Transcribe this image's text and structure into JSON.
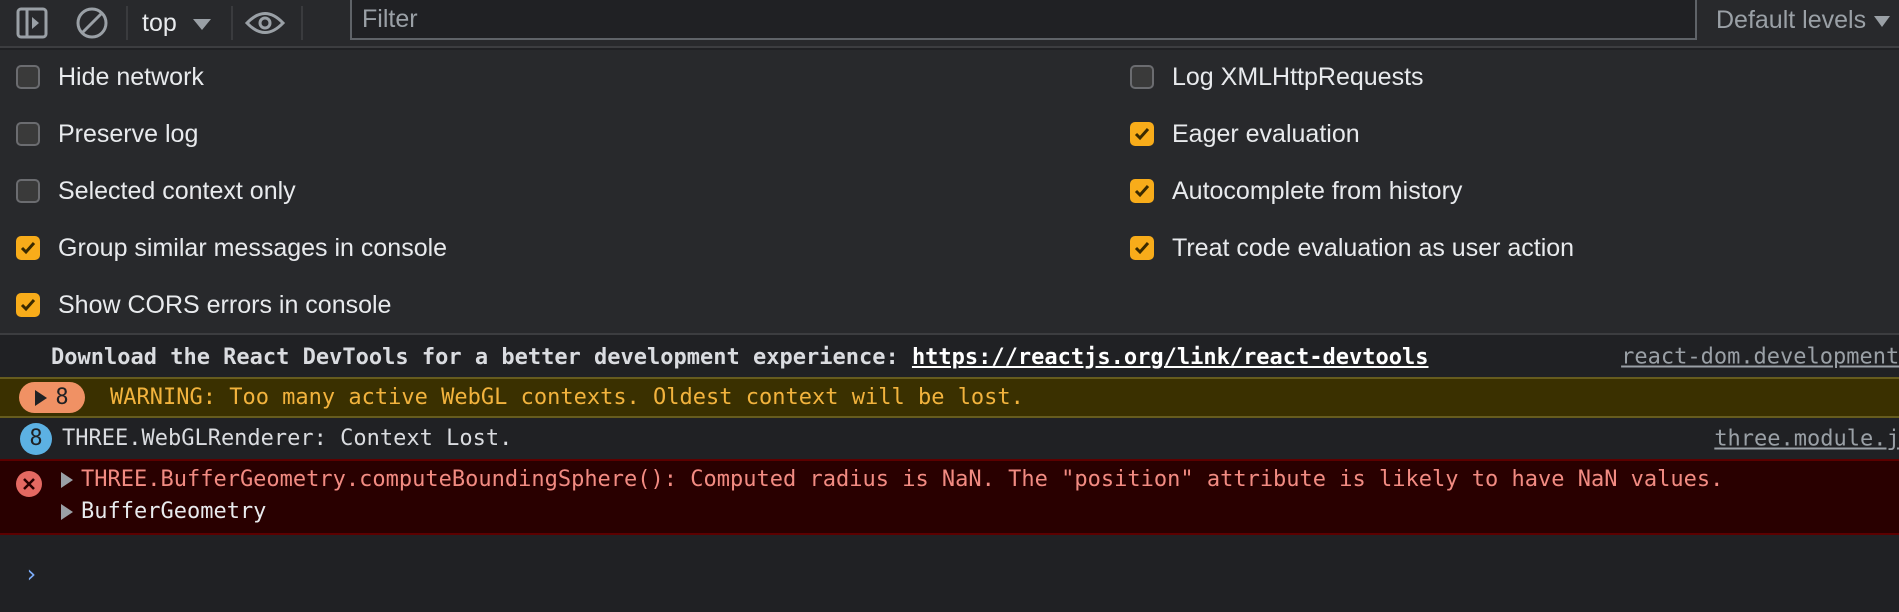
{
  "toolbar": {
    "context": "top",
    "filter_placeholder": "Filter",
    "filter_value": "",
    "levels": "Default levels",
    "icons": [
      "sidebar-toggle-icon",
      "clear-console-icon",
      "eye-icon"
    ]
  },
  "settings": {
    "left": [
      {
        "label": "Hide network",
        "checked": false
      },
      {
        "label": "Preserve log",
        "checked": false
      },
      {
        "label": "Selected context only",
        "checked": false
      },
      {
        "label": "Group similar messages in console",
        "checked": true
      },
      {
        "label": "Show CORS errors in console",
        "checked": true
      }
    ],
    "right": [
      {
        "label": "Log XMLHttpRequests",
        "checked": false
      },
      {
        "label": "Eager evaluation",
        "checked": true
      },
      {
        "label": "Autocomplete from history",
        "checked": true
      },
      {
        "label": "Treat code evaluation as user action",
        "checked": true
      }
    ],
    "accent_color": "#f8ac1a"
  },
  "console": {
    "info": {
      "text": "Download the React DevTools for a better development experience: ",
      "link": "https://reactjs.org/link/react-devtools",
      "source": "react-dom.development.js"
    },
    "warning": {
      "count": "8",
      "text": "WARNING: Too many active WebGL contexts. Oldest context will be lost."
    },
    "log": {
      "count": "8",
      "text": "THREE.WebGLRenderer: Context Lost.",
      "source": "three.module.js"
    },
    "error": {
      "text": "THREE.BufferGeometry.computeBoundingSphere(): Computed radius is NaN. The \"position\" attribute is likely to have NaN values.",
      "object": "BufferGeometry"
    },
    "prompt": "›"
  }
}
